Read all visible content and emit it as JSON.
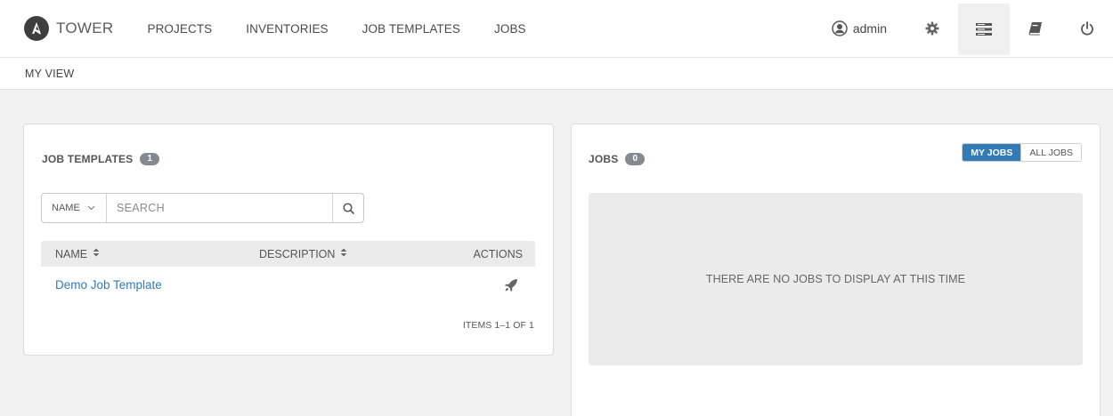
{
  "navbar": {
    "brand": "TOWER",
    "links": [
      "PROJECTS",
      "INVENTORIES",
      "JOB TEMPLATES",
      "JOBS"
    ],
    "user": "admin"
  },
  "subheader": {
    "breadcrumb": "MY VIEW"
  },
  "job_templates": {
    "title": "JOB TEMPLATES",
    "count": "1",
    "search": {
      "key": "NAME",
      "placeholder": "SEARCH"
    },
    "columns": {
      "name": "NAME",
      "description": "DESCRIPTION",
      "actions": "ACTIONS"
    },
    "rows": [
      {
        "name": "Demo Job Template",
        "description": ""
      }
    ],
    "pager": "ITEMS 1–1 OF 1"
  },
  "jobs": {
    "title": "JOBS",
    "count": "0",
    "toggle": {
      "my_jobs": "MY JOBS",
      "all_jobs": "ALL JOBS",
      "active": "MY JOBS"
    },
    "empty_message": "THERE ARE NO JOBS TO DISPLAY AT THIS TIME"
  },
  "colors": {
    "accent": "#337ab7",
    "badge": "#848992",
    "background": "#f2f2f2"
  },
  "icons": {
    "brand": "ansible-logo-icon",
    "user": "user-circle-icon",
    "settings": "gear-icon",
    "portal": "server-list-icon",
    "docs": "book-icon",
    "logout": "power-icon",
    "search": "search-icon",
    "launch": "rocket-icon"
  }
}
